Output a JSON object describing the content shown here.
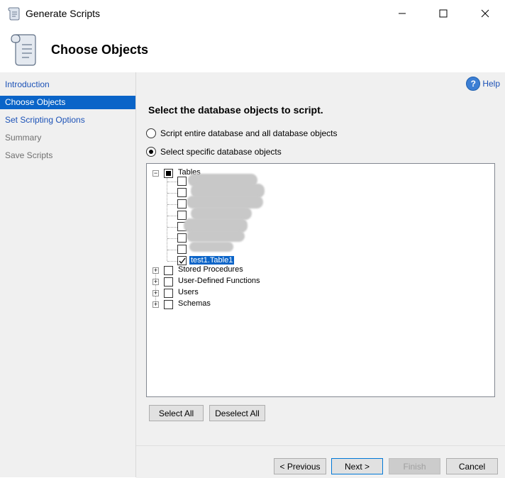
{
  "window": {
    "title": "Generate Scripts",
    "icon": "scroll-icon",
    "controls": [
      "minimize-icon",
      "maximize-icon",
      "close-icon"
    ]
  },
  "header": {
    "title": "Choose Objects",
    "icon": "scroll-icon"
  },
  "nav": {
    "items": [
      {
        "label": "Introduction",
        "state": "link"
      },
      {
        "label": "Choose Objects",
        "state": "selected"
      },
      {
        "label": "Set Scripting Options",
        "state": "link"
      },
      {
        "label": "Summary",
        "state": "disabled"
      },
      {
        "label": "Save Scripts",
        "state": "disabled"
      }
    ]
  },
  "content": {
    "help_label": "Help",
    "section_title": "Select the database objects to script.",
    "radio_options": [
      {
        "label": "Script entire database and all database objects",
        "checked": false
      },
      {
        "label": "Select specific database objects",
        "checked": true
      }
    ]
  },
  "tree": {
    "tables": {
      "label": "Tables",
      "expanded": true,
      "check_state": "partial"
    },
    "table_items": [
      {
        "label": "",
        "checked": false,
        "obscured": true
      },
      {
        "label": "",
        "checked": false,
        "obscured": true
      },
      {
        "label": "",
        "checked": false,
        "obscured": true
      },
      {
        "label": "",
        "checked": false,
        "obscured": true
      },
      {
        "label": "",
        "checked": false,
        "obscured": true
      },
      {
        "label": "",
        "checked": false,
        "obscured": true
      },
      {
        "label": "",
        "checked": false,
        "obscured": true
      },
      {
        "label": "test1.Table1",
        "checked": true,
        "obscured": false
      }
    ],
    "groups": [
      {
        "label": "Stored Procedures",
        "expanded": false,
        "checked": false
      },
      {
        "label": "User-Defined Functions",
        "expanded": false,
        "checked": false
      },
      {
        "label": "Users",
        "expanded": false,
        "checked": false
      },
      {
        "label": "Schemas",
        "expanded": false,
        "checked": false
      }
    ]
  },
  "selection_buttons": {
    "select_all": "Select All",
    "deselect_all": "Deselect All"
  },
  "footer": {
    "previous": "< Previous",
    "next": "Next >",
    "finish": "Finish",
    "cancel": "Cancel"
  },
  "colors": {
    "accent": "#0a64c8",
    "link": "#1c52b7",
    "panel_bg": "#f0f0f0"
  }
}
